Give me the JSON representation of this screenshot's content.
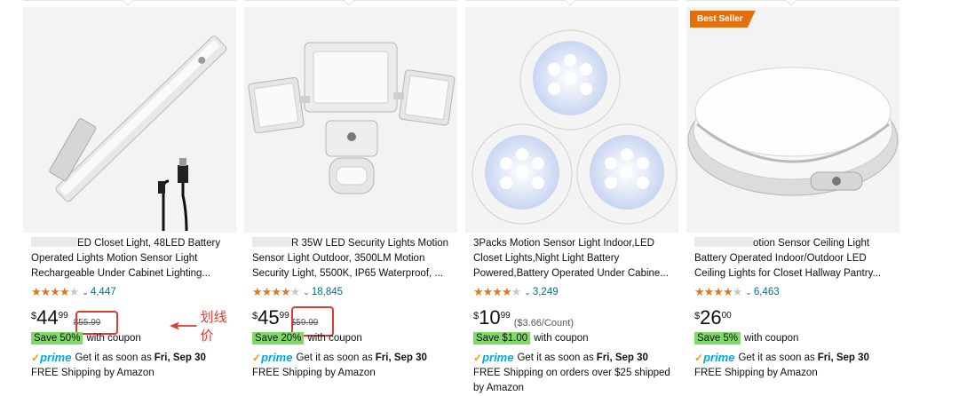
{
  "colors": {
    "star": "#de7921",
    "link": "#007185",
    "save_bg": "#7fda69",
    "prime": "#00a8e1",
    "badge": "#e46f0d",
    "annotation": "#e03a31"
  },
  "products": [
    {
      "badge": "",
      "title": "ED Closet Light, 48LED Battery Operated Lights Motion Sensor Light Rechargeable Under Cabinet Lighting...",
      "rating": 4.5,
      "reviews": "4,447",
      "price_whole": "44",
      "price_frac": "99",
      "list_price": "$55.99",
      "unit_price": "",
      "save": "Save 50%",
      "with_coupon": "with coupon",
      "prime_label": "prime",
      "delivery_prefix": "Get it as soon as",
      "delivery_date": "Fri, Sep 30",
      "shipping": "FREE Shipping by Amazon"
    },
    {
      "badge": "",
      "title": "R 35W LED Security Lights Motion Sensor Light Outdoor, 3500LM Motion Security Light, 5500K, IP65 Waterproof, ...",
      "rating": 4.5,
      "reviews": "18,845",
      "price_whole": "45",
      "price_frac": "99",
      "list_price": "$59.99",
      "unit_price": "",
      "save": "Save 20%",
      "with_coupon": "with coupon",
      "prime_label": "prime",
      "delivery_prefix": "Get it as soon as",
      "delivery_date": "Fri, Sep 30",
      "shipping": "FREE Shipping by Amazon"
    },
    {
      "badge": "",
      "title": "3Packs Motion Sensor Light Indoor,LED Closet Lights,Night Light Battery Powered,Battery Operated Under Cabine...",
      "rating": 4.5,
      "reviews": "3,249",
      "price_whole": "10",
      "price_frac": "99",
      "list_price": "",
      "unit_price": "($3.66/Count)",
      "save": "Save $1.00",
      "with_coupon": "with coupon",
      "prime_label": "prime",
      "delivery_prefix": "Get it as soon as",
      "delivery_date": "Fri, Sep 30",
      "shipping": "FREE Shipping on orders over $25 shipped by Amazon"
    },
    {
      "badge": "Best Seller",
      "title": "otion Sensor Ceiling Light Battery Operated Indoor/Outdoor LED Ceiling Lights for Closet Hallway Pantry...",
      "rating": 4.5,
      "reviews": "6,463",
      "price_whole": "26",
      "price_frac": "00",
      "list_price": "",
      "unit_price": "",
      "save": "Save 5%",
      "with_coupon": "with coupon",
      "prime_label": "prime",
      "delivery_prefix": "Get it as soon as",
      "delivery_date": "Fri, Sep 30",
      "shipping": "FREE Shipping by Amazon"
    }
  ],
  "annotation": {
    "text": "划线价"
  },
  "icons": {
    "rating": "star-icon",
    "dropdown": "chevron-down-icon",
    "prime_check": "checkmark-icon",
    "annotation": "arrow-left-icon"
  }
}
